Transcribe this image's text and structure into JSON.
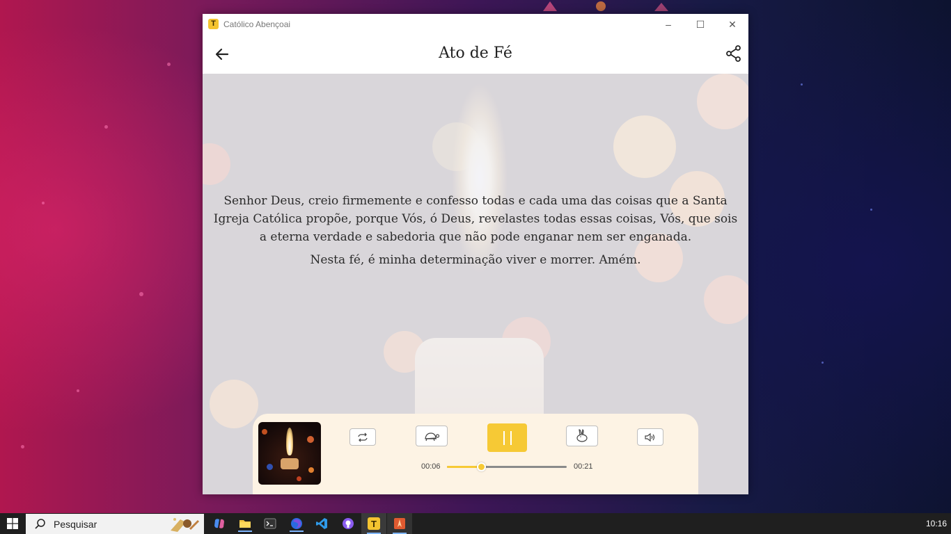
{
  "window": {
    "title": "Católico Abençoai",
    "app_icon_glyph": "T",
    "controls": {
      "minimize": "–",
      "maximize": "☐",
      "close": "✕"
    }
  },
  "appbar": {
    "title": "Ato de Fé",
    "back_icon": "arrow-left-icon",
    "share_icon": "share-icon"
  },
  "prayer": {
    "paragraphs": [
      "Senhor Deus, creio firmemente e confesso todas e cada uma das coisas que a Santa Igreja Católica propõe, porque Vós, ó Deus, revelastes todas essas coisas, Vós, que sois a eterna verdade e sabedoria que não pode enganar nem ser enganada.",
      "Nesta fé, é minha determinação viver e morrer. Amém."
    ]
  },
  "player": {
    "current_time": "00:06",
    "total_time": "00:21",
    "progress": 0.286,
    "buttons": [
      "repeat-icon",
      "slow-speed-turtle-icon",
      "pause-icon",
      "fast-speed-rabbit-icon",
      "volume-icon"
    ],
    "accent": "#f6c935"
  },
  "taskbar": {
    "search_placeholder": "Pesquisar",
    "clock": "10:16"
  },
  "colors": {
    "accent": "#f6c935",
    "taskbar": "#1f1f1f"
  }
}
